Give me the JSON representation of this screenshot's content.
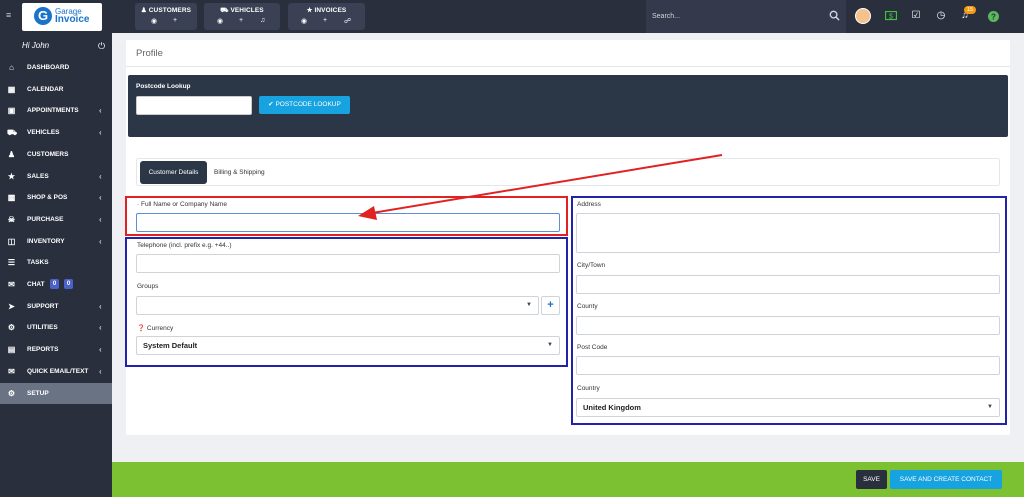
{
  "topbar": {
    "logo_line1": "Garage",
    "logo_line2": "Invoice",
    "groups": [
      {
        "label": "CUSTOMERS",
        "icons": [
          "eye-icon",
          "plus-icon"
        ]
      },
      {
        "label": "VEHICLES",
        "icons": [
          "eye-icon",
          "plus-icon",
          "bell-icon"
        ]
      },
      {
        "label": "INVOICES",
        "icons": [
          "eye-icon",
          "plus-icon",
          "link-icon"
        ]
      }
    ],
    "search_placeholder": "Search...",
    "notification_count": "15"
  },
  "sidebar": {
    "greeting": "Hi John",
    "items": [
      {
        "label": "DASHBOARD",
        "icon": "home-icon",
        "chevron": false
      },
      {
        "label": "CALENDAR",
        "icon": "calendar-icon",
        "chevron": false
      },
      {
        "label": "APPOINTMENTS",
        "icon": "calendar-check-icon",
        "chevron": true
      },
      {
        "label": "VEHICLES",
        "icon": "car-icon",
        "chevron": true
      },
      {
        "label": "CUSTOMERS",
        "icon": "user-icon",
        "chevron": false
      },
      {
        "label": "SALES",
        "icon": "star-icon",
        "chevron": true
      },
      {
        "label": "SHOP & POS",
        "icon": "shop-icon",
        "chevron": true
      },
      {
        "label": "PURCHASE",
        "icon": "cart-icon",
        "chevron": true
      },
      {
        "label": "INVENTORY",
        "icon": "box-icon",
        "chevron": true
      },
      {
        "label": "TASKS",
        "icon": "list-icon",
        "chevron": false
      },
      {
        "label": "CHAT",
        "icon": "chat-icon",
        "chevron": false,
        "badges": [
          "0",
          "0"
        ]
      },
      {
        "label": "SUPPORT",
        "icon": "send-icon",
        "chevron": true
      },
      {
        "label": "UTILITIES",
        "icon": "cogs-icon",
        "chevron": true
      },
      {
        "label": "REPORTS",
        "icon": "chart-icon",
        "chevron": true
      },
      {
        "label": "QUICK EMAIL/TEXT",
        "icon": "envelope-icon",
        "chevron": true
      },
      {
        "label": "SETUP",
        "icon": "gear-icon",
        "chevron": false,
        "active": true
      }
    ]
  },
  "page": {
    "title": "Profile",
    "postcode_label": "Postcode Lookup",
    "postcode_button": "POSTCODE LOOKUP",
    "tabs": [
      "Customer Details",
      "Billing & Shipping"
    ],
    "left_fields": {
      "name_label": "· Full Name or Company Name",
      "telephone_label": "Telephone (incl. prefix e.g. +44..)",
      "groups_label": "Groups",
      "currency_label": "Currency",
      "currency_value": "System Default"
    },
    "right_fields": {
      "address_label": "Address",
      "city_label": "City/Town",
      "county_label": "County",
      "postcode_label": "Post Code",
      "country_label": "Country",
      "country_value": "United Kingdom"
    }
  },
  "footer": {
    "save_label": "SAVE",
    "save_create_label": "SAVE AND CREATE CONTACT"
  },
  "colors": {
    "sidebar_bg": "#2a2f3e",
    "accent_blue": "#17a2e0",
    "footer_green": "#7cc132",
    "annotation_red": "#e02222",
    "annotation_blue": "#2222aa"
  }
}
